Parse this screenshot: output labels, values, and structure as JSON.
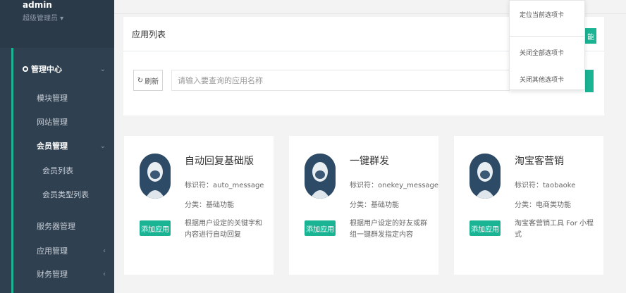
{
  "sidebar": {
    "user_name": "admin",
    "user_role": "超级管理员 ▾",
    "menu": {
      "head_icon": "location-pin-icon",
      "head_label": "管理中心",
      "items": [
        {
          "label": "模块管理"
        },
        {
          "label": "网站管理"
        },
        {
          "label": "会员管理"
        },
        {
          "label": "服务器管理"
        },
        {
          "label": "应用管理"
        },
        {
          "label": "财务管理"
        }
      ],
      "sub_items": [
        {
          "label": "会员列表"
        },
        {
          "label": "会员类型列表"
        }
      ]
    }
  },
  "panel": {
    "title": "应用列表",
    "refresh_label": "刷新",
    "search_placeholder": "请输入要查询的应用名称",
    "right_tab_label": "能"
  },
  "dropdown": {
    "items": [
      {
        "label": "定位当前选项卡"
      },
      {
        "label": "关闭全部选项卡"
      },
      {
        "label": "关闭其他选项卡"
      }
    ]
  },
  "cards": [
    {
      "title": "自动回复基础版",
      "id_label": "标识符：auto_message",
      "category": "分类：基础功能",
      "desc": "根据用户设定的关键字和内容进行自动回复",
      "button": "添加应用"
    },
    {
      "title": "一键群发",
      "id_label": "标识符：onekey_message",
      "category": "分类：基础功能",
      "desc": "根据用户设定的好友或群组一键群发指定内容",
      "button": "添加应用"
    },
    {
      "title": "淘宝客营销",
      "id_label": "标识符：taobaoke",
      "category": "分类：电商类功能",
      "desc": "淘宝客营销工具 For 小程式",
      "button": "添加应用"
    }
  ],
  "colors": {
    "accent": "#1ab394",
    "sidebar": "#2f4050"
  }
}
